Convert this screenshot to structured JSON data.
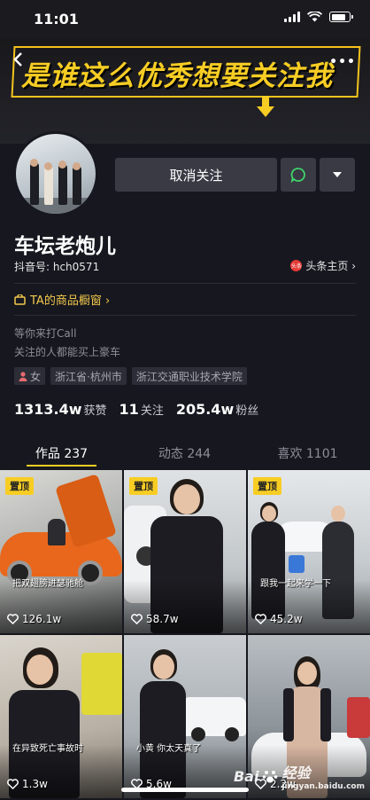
{
  "status_bar": {
    "time": "11:01"
  },
  "banner": {
    "text": "是谁这么优秀想要关注我"
  },
  "profile": {
    "unfollow_label": "取消关注",
    "nickname": "车坛老炮儿",
    "douyin_id": "抖音号: hch0571",
    "toutiao_badge": "头条",
    "toutiao_link": "头条主页 ›",
    "shop_label": "TA的商品橱窗 ›",
    "bio_lines": [
      "等你来打Call",
      "关注的人都能买上豪车"
    ],
    "tags": [
      {
        "label": "女",
        "icon": "person-icon"
      },
      {
        "label": "浙江省·杭州市"
      },
      {
        "label": "浙江交通职业技术学院"
      }
    ],
    "stats": [
      {
        "num": "1313.4w",
        "label": "获赞"
      },
      {
        "num": "11",
        "label": "关注"
      },
      {
        "num": "205.4w",
        "label": "粉丝"
      }
    ]
  },
  "tabs": [
    {
      "label": "作品 237",
      "active": true
    },
    {
      "label": "动态 244",
      "active": false
    },
    {
      "label": "喜欢 1101",
      "active": false
    }
  ],
  "videos": [
    {
      "pinned": "置顶",
      "caption": "把双翅膀进瑟驰舱",
      "likes": "126.1w"
    },
    {
      "pinned": "置顶",
      "caption": "",
      "likes": "58.7w"
    },
    {
      "pinned": "置顶",
      "caption": "跟我一起来学一下",
      "likes": "45.2w"
    },
    {
      "pinned": "",
      "caption": "在异致死亡事故时",
      "likes": "1.3w"
    },
    {
      "pinned": "",
      "caption": "小黄 你太天真了",
      "likes": "5.6w"
    },
    {
      "pinned": "",
      "caption": "",
      "likes": "2.2w"
    }
  ],
  "watermark": {
    "brand": "Bai",
    "brand2": "经验",
    "sub": "jingyan.baidu.com"
  },
  "colors": {
    "accent": "#f7cd24",
    "background": "#16171f",
    "button": "#393a44",
    "chat_icon": "#3fd56a"
  }
}
